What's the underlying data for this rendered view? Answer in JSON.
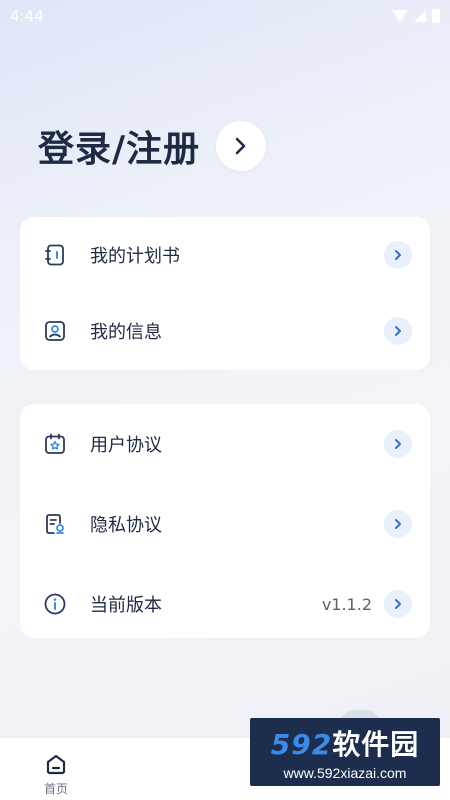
{
  "status_bar": {
    "time": "4:44"
  },
  "login": {
    "title": "登录/注册"
  },
  "card1": {
    "items": [
      {
        "label": "我的计划书",
        "icon": "notebook-icon"
      },
      {
        "label": "我的信息",
        "icon": "profile-icon"
      }
    ]
  },
  "card2": {
    "items": [
      {
        "label": "用户协议",
        "icon": "calendar-star-icon"
      },
      {
        "label": "隐私协议",
        "icon": "privacy-doc-icon"
      },
      {
        "label": "当前版本",
        "icon": "info-icon",
        "value": "v1.1.2"
      }
    ]
  },
  "bottom_nav": {
    "home_label": "首页"
  },
  "watermark": {
    "logo_number": "592",
    "logo_text": "软件园",
    "url": "www.592xiazai.com"
  },
  "colors": {
    "primary_text": "#1f2a44",
    "chevron_bg": "#e9f0fb",
    "chevron": "#3a6fc9"
  }
}
